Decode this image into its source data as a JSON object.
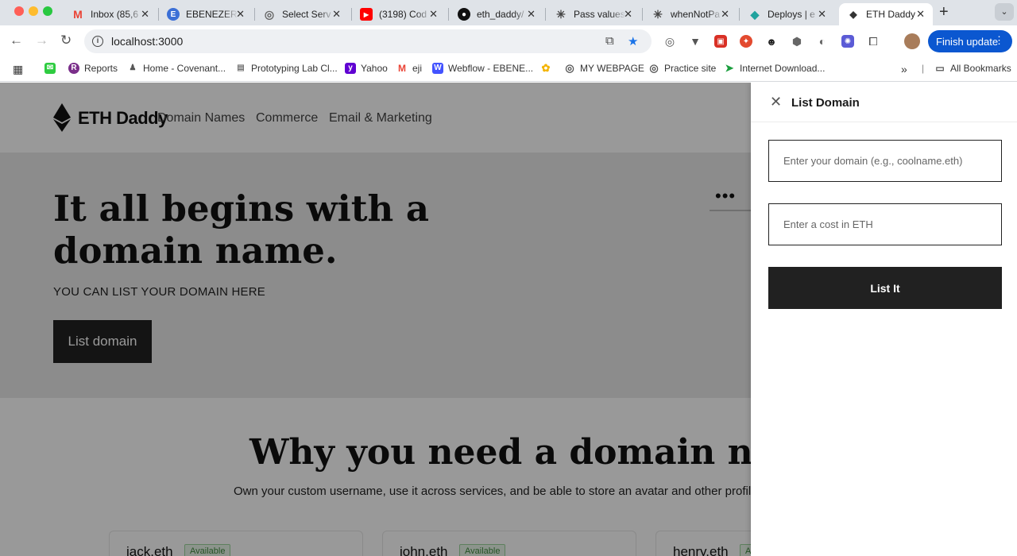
{
  "browser": {
    "tabs": [
      {
        "title": "Inbox (85,6",
        "icon": "gmail-icon",
        "color": "#ea4335",
        "glyph": "M"
      },
      {
        "title": "EBENEZER",
        "icon": "ebenezer-icon",
        "color": "#3b6fd6",
        "glyph": "E"
      },
      {
        "title": "Select Serv",
        "icon": "globe-icon",
        "color": "#666666",
        "glyph": "◎"
      },
      {
        "title": "(3198) Cod",
        "icon": "youtube-icon",
        "color": "#ff0000",
        "glyph": "▶"
      },
      {
        "title": "eth_daddy/",
        "icon": "github-icon",
        "color": "#111111",
        "glyph": "●"
      },
      {
        "title": "Pass values",
        "icon": "openai-icon",
        "color": "#444444",
        "glyph": "✳"
      },
      {
        "title": "whenNotPa",
        "icon": "openai-icon",
        "color": "#444444",
        "glyph": "✳"
      },
      {
        "title": "Deploys | e",
        "icon": "netlify-icon",
        "color": "#20a39e",
        "glyph": "◆"
      },
      {
        "title": "ETH Daddy",
        "icon": "ethereum-icon",
        "color": "#333333",
        "glyph": "◆"
      }
    ],
    "url": "localhost:3000",
    "finish_update": "Finish update",
    "extension_badge": "1",
    "bookmarks": [
      {
        "label": "Reports",
        "icon": "reports-icon"
      },
      {
        "label": "Home - Covenant...",
        "icon": "covenant-icon"
      },
      {
        "label": "Prototyping Lab Cl...",
        "icon": "lab-icon"
      },
      {
        "label": "Yahoo",
        "icon": "yahoo-icon"
      },
      {
        "label": "eji",
        "icon": "gmail-icon"
      },
      {
        "label": "Webflow - EBENE...",
        "icon": "webflow-icon"
      },
      {
        "label": "",
        "icon": "photos-icon"
      },
      {
        "label": "MY WEBPAGE",
        "icon": "globe-icon"
      },
      {
        "label": "Practice site",
        "icon": "globe-icon"
      },
      {
        "label": "Internet Download...",
        "icon": "idm-icon"
      }
    ],
    "all_bookmarks": "All Bookmarks"
  },
  "site": {
    "brand": "ETH Daddy",
    "nav": [
      "Domain Names",
      "Commerce",
      "Email & Marketing"
    ],
    "hero_title": "It all begins with a domain name.",
    "hero_subtitle": "YOU CAN LIST YOUR DOMAIN HERE",
    "hero_button": "List domain",
    "hero_dots": "•••",
    "why_title": "Why you need a domain name",
    "why_subtitle": "Own your custom username, use it across services, and be able to store an avatar and other profile",
    "cards": [
      {
        "name": "jack.eth",
        "status": "Available"
      },
      {
        "name": "john.eth",
        "status": "Available"
      },
      {
        "name": "henry.eth",
        "status": "Available"
      }
    ]
  },
  "drawer": {
    "title": "List Domain",
    "domain_placeholder": "Enter your domain (e.g., coolname.eth)",
    "domain_value": "",
    "cost_placeholder": "Enter a cost in ETH",
    "cost_value": "",
    "submit_label": "List It"
  }
}
